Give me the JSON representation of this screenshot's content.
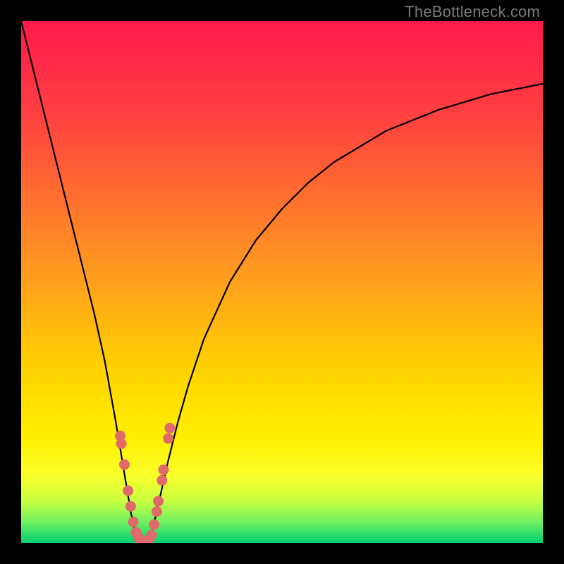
{
  "watermark": "TheBottleneck.com",
  "colors": {
    "background": "#000000",
    "curve": "#000000",
    "markers": "#e06a6a",
    "gradient_top": "#ff1a4a",
    "gradient_bottom": "#00d070"
  },
  "chart_data": {
    "type": "line",
    "title": "",
    "xlabel": "",
    "ylabel": "",
    "xlim": [
      0,
      100
    ],
    "ylim": [
      0,
      100
    ],
    "x": [
      0,
      2,
      4,
      6,
      8,
      10,
      12,
      14,
      16,
      18,
      19,
      20,
      21,
      22,
      23,
      24,
      25,
      26,
      28,
      30,
      32,
      35,
      40,
      45,
      50,
      55,
      60,
      65,
      70,
      75,
      80,
      85,
      90,
      95,
      100
    ],
    "y": [
      100,
      92,
      84,
      76,
      68,
      60,
      52,
      44,
      35,
      24,
      18,
      12,
      6,
      1,
      0,
      0,
      2,
      6,
      15,
      23,
      30,
      39,
      50,
      58,
      64,
      69,
      73,
      76,
      79,
      81,
      83,
      84.5,
      86,
      87,
      88
    ],
    "series": [
      {
        "name": "curve",
        "x": [
          0,
          2,
          4,
          6,
          8,
          10,
          12,
          14,
          16,
          18,
          19,
          20,
          21,
          22,
          23,
          24,
          25,
          26,
          28,
          30,
          32,
          35,
          40,
          45,
          50,
          55,
          60,
          65,
          70,
          75,
          80,
          85,
          90,
          95,
          100
        ],
        "y": [
          100,
          92,
          84,
          76,
          68,
          60,
          52,
          44,
          35,
          24,
          18,
          12,
          6,
          1,
          0,
          0,
          2,
          6,
          15,
          23,
          30,
          39,
          50,
          58,
          64,
          69,
          73,
          76,
          79,
          81,
          83,
          84.5,
          86,
          87,
          88
        ]
      }
    ],
    "markers": {
      "name": "highlighted-points",
      "color": "#e06a6a",
      "x": [
        19.0,
        19.2,
        19.8,
        20.5,
        21.0,
        21.5,
        22.0,
        22.5,
        23.0,
        23.5,
        24.0,
        24.5,
        25.0,
        25.5,
        26.0,
        26.3,
        27.0,
        27.3,
        28.2,
        28.5
      ],
      "y": [
        20.5,
        19.0,
        15.0,
        10.0,
        7.0,
        4.0,
        2.0,
        1.0,
        0.5,
        0.3,
        0.3,
        0.5,
        1.5,
        3.5,
        6.0,
        8.0,
        12.0,
        14.0,
        20.0,
        22.0
      ]
    }
  }
}
